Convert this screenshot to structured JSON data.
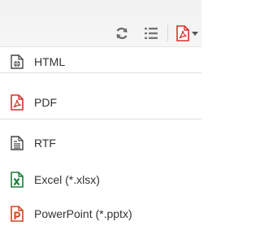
{
  "toolbar": {
    "buttons": [
      {
        "icon": "refresh-icon"
      },
      {
        "icon": "list-icon"
      },
      {
        "icon": "pdf-export-icon"
      }
    ],
    "colors": {
      "icon_gray": "#666666",
      "pdf_red": "#d9302c"
    }
  },
  "menu": {
    "items": [
      {
        "label": "HTML",
        "icon": "html-file-icon"
      },
      {
        "label": "PDF",
        "icon": "pdf-file-icon"
      },
      {
        "label": "RTF",
        "icon": "rtf-file-icon"
      },
      {
        "label": "Excel (*.xlsx)",
        "icon": "excel-file-icon"
      },
      {
        "label": "PowerPoint (*.pptx)",
        "icon": "powerpoint-file-icon"
      }
    ],
    "colors": {
      "pdf": "#d9302c",
      "excel": "#1d7c3a",
      "powerpoint": "#d04423",
      "text": "#333333"
    }
  }
}
